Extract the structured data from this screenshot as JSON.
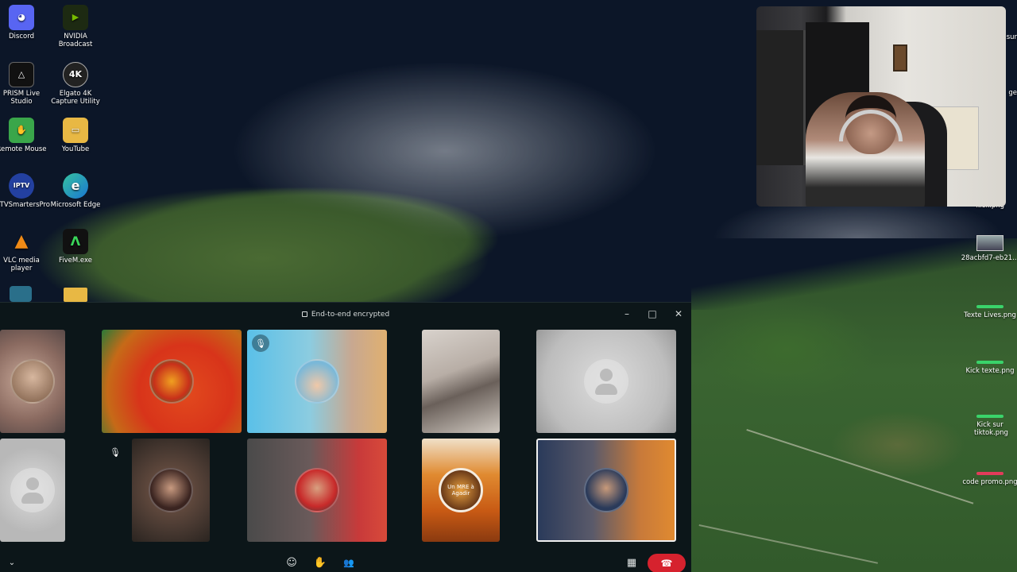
{
  "desktop": {
    "icons": [
      {
        "label": "Discord",
        "glyph": "◕"
      },
      {
        "label": "NVIDIA Broadcast",
        "glyph": "▶"
      },
      {
        "label": "PRISM Live Studio",
        "glyph": "△"
      },
      {
        "label": "Elgato 4K Capture Utility",
        "glyph": "4K"
      },
      {
        "label": "Remote Mouse",
        "glyph": "✋"
      },
      {
        "label": "YouTube",
        "glyph": "▭"
      },
      {
        "label": "IPTVSmartersPro",
        "glyph": "IPTV"
      },
      {
        "label": "Microsoft Edge",
        "glyph": "e"
      },
      {
        "label": "VLC media player",
        "glyph": "▲"
      },
      {
        "label": "FiveM.exe",
        "glyph": "Λ"
      }
    ],
    "right_icons": [
      {
        "label": "28acbfd7-eb21..."
      },
      {
        "label": "Texte Lives.png"
      },
      {
        "label": "Kick texte.png"
      },
      {
        "label": "Kick sur tiktok.png"
      },
      {
        "label": "code promo.png"
      }
    ],
    "partial_labels": {
      "sur": "sur",
      "ge": "ge",
      "kick_png": "kick.png"
    }
  },
  "call": {
    "title": "End-to-end encrypted",
    "window_buttons": {
      "minimize": "–",
      "maximize": "□",
      "close": "✕"
    },
    "controls": {
      "emoji": "☺",
      "raise_hand": "✋",
      "participants": "👥",
      "layout": "▦",
      "hangup": "☎"
    },
    "tiles": [
      {
        "row": 1,
        "type": "photo",
        "muted": false
      },
      {
        "row": 1,
        "type": "lion-avatar",
        "muted": false
      },
      {
        "row": 1,
        "type": "cartoon-avatar",
        "muted": true
      },
      {
        "row": 1,
        "type": "video",
        "muted": false
      },
      {
        "row": 1,
        "type": "placeholder",
        "muted": false
      },
      {
        "row": 2,
        "type": "placeholder",
        "muted": false
      },
      {
        "row": 2,
        "type": "photo",
        "muted": true
      },
      {
        "row": 2,
        "type": "photo",
        "muted": false
      },
      {
        "row": 2,
        "type": "logo",
        "muted": false,
        "logo_text": "Un MRE à Agadir"
      },
      {
        "row": 2,
        "type": "illustrated-avatar",
        "muted": false,
        "active": true
      }
    ]
  },
  "colors": {
    "hangup": "#d6222e",
    "window_bg": "#0c1619"
  }
}
